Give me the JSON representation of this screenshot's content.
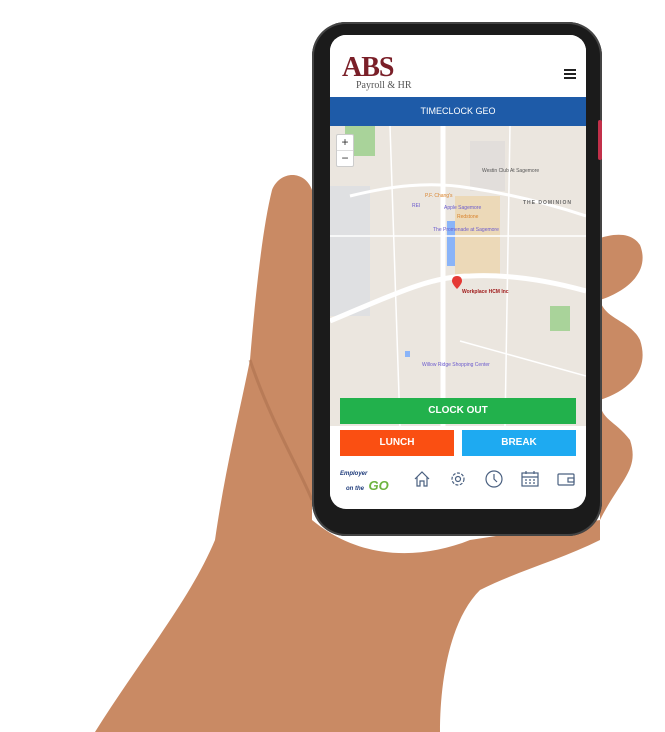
{
  "app": {
    "logo_text": "ABS",
    "logo_subtitle": "Payroll & HR",
    "title": "TIMECLOCK GEO"
  },
  "map": {
    "zoom_in": "+",
    "zoom_out": "−",
    "labels": {
      "westin": "Westin Club At Sagemore",
      "pfchangs": "P.F. Chang's",
      "rei": "REI",
      "apple": "Apple Sagemore",
      "redstone": "Redstone",
      "promenade": "The Promenade at Sagemore",
      "dominion": "THE DOMINION",
      "workplace": "Workplace HCM Inc",
      "willow": "Willow Ridge Shopping Center"
    }
  },
  "actions": {
    "clock_out": "CLOCK OUT",
    "lunch": "LUNCH",
    "break": "BREAK"
  },
  "colors": {
    "clock_out": "#22b14c",
    "lunch": "#fa4f12",
    "break": "#1eaaf1",
    "title_bar": "#1e5ba8",
    "logo": "#7a1f28"
  },
  "nav": {
    "brand_line1": "Employer",
    "brand_line2": "on the",
    "brand_go": "GO",
    "icons": [
      "home-icon",
      "gear-icon",
      "clock-icon",
      "calendar-icon",
      "wallet-icon"
    ]
  }
}
